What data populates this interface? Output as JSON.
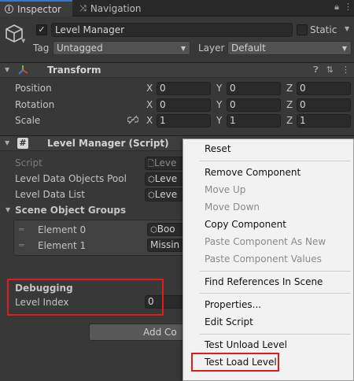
{
  "tabs": [
    {
      "label": "Inspector",
      "icon": "info-icon"
    },
    {
      "label": "Navigation",
      "icon": "navigation-icon"
    }
  ],
  "gameobject": {
    "name": "Level Manager",
    "static_label": "Static",
    "tag_label": "Tag",
    "tag_value": "Untagged",
    "layer_label": "Layer",
    "layer_value": "Default"
  },
  "transform": {
    "title": "Transform",
    "rows": [
      {
        "label": "Position",
        "x": "0",
        "y": "0",
        "z": "0"
      },
      {
        "label": "Rotation",
        "x": "0",
        "y": "0",
        "z": "0"
      },
      {
        "label": "Scale",
        "x": "1",
        "y": "1",
        "z": "1"
      }
    ],
    "axis": [
      "X",
      "Y",
      "Z"
    ]
  },
  "script_component": {
    "title": "Level Manager (Script)",
    "script_label": "Script",
    "script_value": "Leve",
    "pool_label": "Level Data Objects Pool",
    "pool_value": "Leve",
    "list_label": "Level Data List",
    "list_value": "Leve",
    "groups_title": "Scene Object Groups",
    "groups": [
      {
        "label": "Element 0",
        "value": "Boo"
      },
      {
        "label": "Element 1",
        "value": "Missin"
      }
    ],
    "debug_title": "Debugging",
    "level_index_label": "Level Index",
    "level_index_value": "0"
  },
  "add_component_label": "Add Co",
  "context_menu": {
    "items": [
      {
        "label": "Reset",
        "enabled": true
      },
      {
        "label": "Remove Component",
        "enabled": true
      },
      {
        "label": "Move Up",
        "enabled": false
      },
      {
        "label": "Move Down",
        "enabled": false
      },
      {
        "label": "Copy Component",
        "enabled": true
      },
      {
        "label": "Paste Component As New",
        "enabled": false
      },
      {
        "label": "Paste Component Values",
        "enabled": false
      },
      {
        "label": "Find References In Scene",
        "enabled": true
      },
      {
        "label": "Properties...",
        "enabled": true
      },
      {
        "label": "Edit Script",
        "enabled": true
      },
      {
        "label": "Test Unload Level",
        "enabled": true
      },
      {
        "label": "Test Load Level",
        "enabled": true
      }
    ]
  },
  "colors": {
    "highlight": "#e01c1c",
    "tab_accent": "#3a79bb",
    "panel_bg": "#383838"
  }
}
